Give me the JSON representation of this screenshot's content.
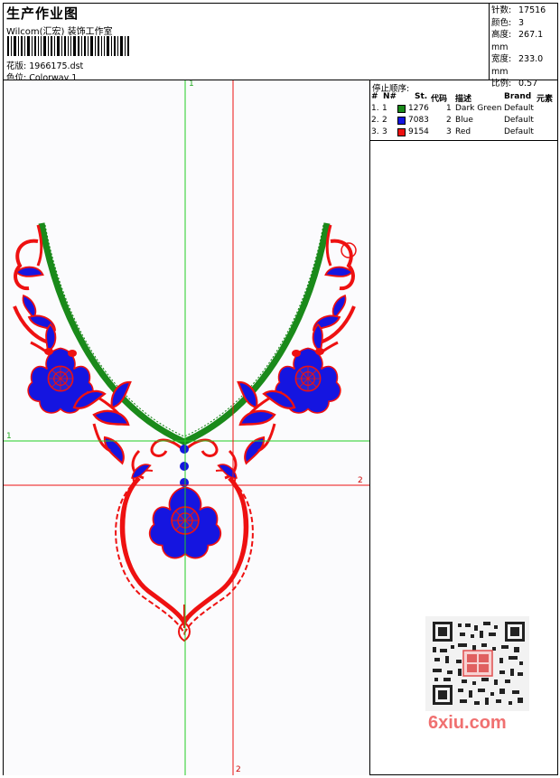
{
  "header": {
    "title": "生产作业图",
    "company": "Wilcom(汇宏) 装饰工作室",
    "design_label": "花版:",
    "design_value": "1966175.dst",
    "colorway_label": "色位:",
    "colorway_value": "Colorway 1"
  },
  "stats": [
    {
      "label": "针数:",
      "value": "17516"
    },
    {
      "label": "颜色:",
      "value": "3"
    },
    {
      "label": "高度:",
      "value": "267.1 mm"
    },
    {
      "label": "宽度:",
      "value": "233.0 mm"
    },
    {
      "label": "比例:",
      "value": "0.57"
    }
  ],
  "guides": {
    "green_label_top": "1",
    "green_label_left": "1",
    "red_label_right": "2",
    "red_label_bottom": "2"
  },
  "stop_sequence": {
    "title": "停止顺序:",
    "headers": {
      "num": "#",
      "needle": "N#",
      "stitches": "St.",
      "code": "代码",
      "description": "描述",
      "brand": "Brand",
      "element": "元素"
    },
    "rows": [
      {
        "num": "1.",
        "needle": "1",
        "color": "#1a8a1a",
        "stitches": "1276",
        "code": "1",
        "description": "Dark Green",
        "brand": "Default"
      },
      {
        "num": "2.",
        "needle": "2",
        "color": "#1515e0",
        "stitches": "7083",
        "code": "2",
        "description": "Blue",
        "brand": "Default"
      },
      {
        "num": "3.",
        "needle": "3",
        "color": "#ee1111",
        "stitches": "9154",
        "code": "3",
        "description": "Red",
        "brand": "Default"
      }
    ]
  },
  "colors": {
    "green": "#1a8a1a",
    "blue": "#1515e0",
    "red": "#ee1111"
  },
  "watermark": {
    "text": "6xiu.com"
  }
}
